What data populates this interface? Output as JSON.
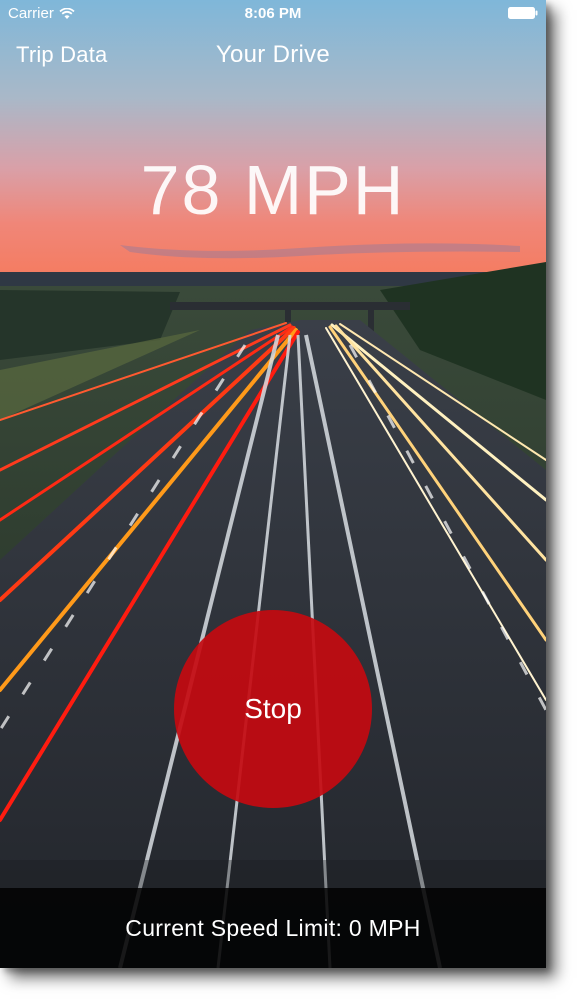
{
  "status_bar": {
    "carrier": "Carrier",
    "time": "8:06 PM",
    "wifi_icon": "wifi-icon",
    "battery_icon": "battery-icon"
  },
  "nav": {
    "left_label": "Trip Data",
    "title": "Your Drive"
  },
  "speed": {
    "value": "78 MPH"
  },
  "stop_button": {
    "label": "Stop",
    "color": "#c40a10"
  },
  "bottom_bar": {
    "speed_limit_text": "Current Speed Limit: 0 MPH"
  },
  "colors": {
    "sky_top": "#7fb6d8",
    "sky_sunset": "#f07a6a",
    "road": "#2b2f36"
  }
}
